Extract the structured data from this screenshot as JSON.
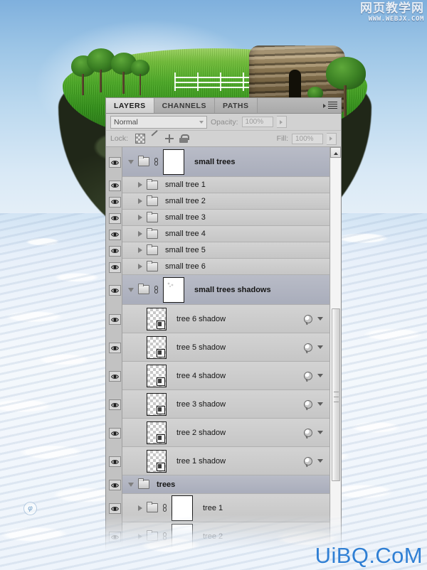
{
  "scene": {
    "description": "Floating grass island with trees, white fence and rock cave over a sea of clouds",
    "sky_color": "#9cc5e6",
    "grass_color": "#49a723",
    "rock_color": "#2a331f",
    "cloud_color": "#eef4fa",
    "ps_badge": "φ"
  },
  "watermarks": {
    "top_cn": "网页教学网",
    "top_url": "WWW.WEBJX.COM",
    "bottom": "UiBQ.CoM",
    "bottom_color": "#2f7fd4"
  },
  "panel": {
    "tabs": [
      {
        "label": "LAYERS",
        "active": true
      },
      {
        "label": "CHANNELS",
        "active": false
      },
      {
        "label": "PATHS",
        "active": false
      }
    ],
    "menu_icon": "panel-menu-icon",
    "blend_mode": {
      "value": "Normal",
      "icon": "chevron-down-icon"
    },
    "opacity": {
      "label": "Opacity:",
      "value": "100%",
      "icon": "spinner-arrow-icon"
    },
    "fill": {
      "label": "Fill:",
      "value": "100%",
      "icon": "spinner-arrow-icon"
    },
    "lock": {
      "label": "Lock:",
      "icons": [
        {
          "name": "lock-transparency-icon",
          "glyph": "checkerboard"
        },
        {
          "name": "lock-image-pixels-icon",
          "glyph": "brush"
        },
        {
          "name": "lock-position-icon",
          "glyph": "move-cross"
        },
        {
          "name": "lock-all-icon",
          "glyph": "padlock"
        }
      ]
    },
    "scrollbar": {
      "up_arrow": "scroll-up-arrow-icon",
      "thumb_top_pct": 38,
      "thumb_height_pct": 44
    },
    "layers": [
      {
        "name": "small trees",
        "type": "group",
        "indent": 0,
        "expanded": true,
        "bold": true,
        "selected": true,
        "visible": true,
        "thumb": "mask-white",
        "linked": true,
        "has_fx": false
      },
      {
        "name": "small tree 1",
        "type": "group",
        "indent": 1,
        "expanded": false,
        "bold": false,
        "selected": false,
        "visible": true,
        "thumb": "none",
        "linked": false,
        "has_fx": false
      },
      {
        "name": "small tree 2",
        "type": "group",
        "indent": 1,
        "expanded": false,
        "bold": false,
        "selected": false,
        "visible": true,
        "thumb": "none",
        "linked": false,
        "has_fx": false
      },
      {
        "name": "small tree 3",
        "type": "group",
        "indent": 1,
        "expanded": false,
        "bold": false,
        "selected": false,
        "visible": true,
        "thumb": "none",
        "linked": false,
        "has_fx": false
      },
      {
        "name": "small tree 4",
        "type": "group",
        "indent": 1,
        "expanded": false,
        "bold": false,
        "selected": false,
        "visible": true,
        "thumb": "none",
        "linked": false,
        "has_fx": false
      },
      {
        "name": "small tree 5",
        "type": "group",
        "indent": 1,
        "expanded": false,
        "bold": false,
        "selected": false,
        "visible": true,
        "thumb": "none",
        "linked": false,
        "has_fx": false
      },
      {
        "name": "small tree 6",
        "type": "group",
        "indent": 1,
        "expanded": false,
        "bold": false,
        "selected": false,
        "visible": true,
        "thumb": "none",
        "linked": false,
        "has_fx": false
      },
      {
        "name": "small trees shadows",
        "type": "group",
        "indent": 0,
        "expanded": true,
        "bold": true,
        "selected": true,
        "visible": true,
        "thumb": "mask-dots",
        "linked": true,
        "has_fx": false
      },
      {
        "name": "tree 6 shadow",
        "type": "layer",
        "indent": 1,
        "expanded": false,
        "bold": false,
        "selected": false,
        "visible": true,
        "thumb": "transparent",
        "linked": false,
        "has_fx": true
      },
      {
        "name": "tree 5 shadow",
        "type": "layer",
        "indent": 1,
        "expanded": false,
        "bold": false,
        "selected": false,
        "visible": true,
        "thumb": "transparent",
        "linked": false,
        "has_fx": true
      },
      {
        "name": "tree 4 shadow",
        "type": "layer",
        "indent": 1,
        "expanded": false,
        "bold": false,
        "selected": false,
        "visible": true,
        "thumb": "transparent",
        "linked": false,
        "has_fx": true
      },
      {
        "name": "tree 3 shadow",
        "type": "layer",
        "indent": 1,
        "expanded": false,
        "bold": false,
        "selected": false,
        "visible": true,
        "thumb": "transparent",
        "linked": false,
        "has_fx": true
      },
      {
        "name": "tree 2 shadow",
        "type": "layer",
        "indent": 1,
        "expanded": false,
        "bold": false,
        "selected": false,
        "visible": true,
        "thumb": "transparent",
        "linked": false,
        "has_fx": true
      },
      {
        "name": "tree 1 shadow",
        "type": "layer",
        "indent": 1,
        "expanded": false,
        "bold": false,
        "selected": false,
        "visible": true,
        "thumb": "transparent",
        "linked": false,
        "has_fx": true
      },
      {
        "name": "trees",
        "type": "group",
        "indent": 0,
        "expanded": true,
        "bold": true,
        "selected": true,
        "visible": true,
        "thumb": "none",
        "linked": false,
        "has_fx": false
      },
      {
        "name": "tree 1",
        "type": "group",
        "indent": 1,
        "expanded": false,
        "bold": false,
        "selected": false,
        "visible": true,
        "thumb": "mask-white",
        "linked": true,
        "has_fx": false
      },
      {
        "name": "tree 2",
        "type": "group",
        "indent": 1,
        "expanded": false,
        "bold": false,
        "selected": false,
        "visible": true,
        "thumb": "mask-soft",
        "linked": true,
        "has_fx": false
      }
    ]
  }
}
